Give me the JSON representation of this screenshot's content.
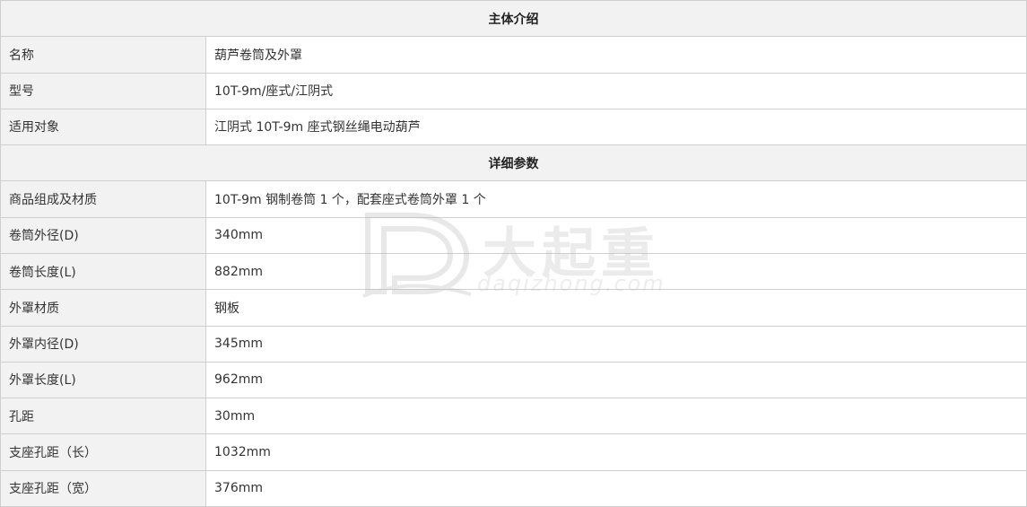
{
  "sections": [
    {
      "title": "主体介绍",
      "rows": [
        {
          "label": "名称",
          "value": "葫芦卷筒及外罩"
        },
        {
          "label": "型号",
          "value": "10T-9m/座式/江阴式"
        },
        {
          "label": "适用对象",
          "value": "江阴式 10T-9m 座式钢丝绳电动葫芦"
        }
      ]
    },
    {
      "title": "详细参数",
      "rows": [
        {
          "label": "商品组成及材质",
          "value": "10T-9m 钢制卷筒 1 个，配套座式卷筒外罩 1 个"
        },
        {
          "label": "卷筒外径(D)",
          "value": "340mm"
        },
        {
          "label": "卷筒长度(L)",
          "value": "882mm"
        },
        {
          "label": "外罩材质",
          "value": "钢板"
        },
        {
          "label": "外罩内径(D)",
          "value": "345mm"
        },
        {
          "label": "外罩长度(L)",
          "value": "962mm"
        },
        {
          "label": "孔距",
          "value": "30mm"
        },
        {
          "label": "支座孔距（长）",
          "value": "1032mm"
        },
        {
          "label": "支座孔距（宽）",
          "value": "376mm"
        }
      ]
    }
  ],
  "watermark": {
    "brand_cn": "大起重",
    "brand_en": "daqizhong.com",
    "logo": "dq-logo-icon"
  }
}
